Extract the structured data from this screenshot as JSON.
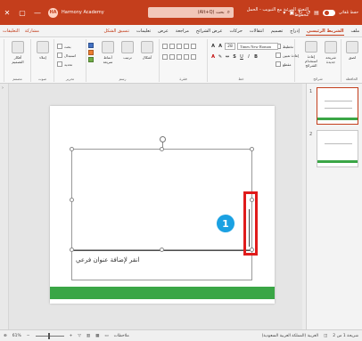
{
  "titlebar": {
    "account_name": "Harmony Academy",
    "avatar_initials": "HA",
    "search_placeholder": "بحث (Alt+Q)",
    "doc_title": "التعبئة المرئية مع التبويب - الحمل محفوظ",
    "autosave_label": "حفظ تلقائي",
    "win_controls": [
      "✕",
      "▢",
      "—"
    ]
  },
  "ribbon_tabs": {
    "tabs": [
      {
        "label": "ملف"
      },
      {
        "label": "الشريط الرئيسي",
        "active": true
      },
      {
        "label": "إدراج"
      },
      {
        "label": "تصميم"
      },
      {
        "label": "انتقالات"
      },
      {
        "label": "حركات"
      },
      {
        "label": "عرض الشرائح"
      },
      {
        "label": "مراجعة"
      },
      {
        "label": "عرض"
      },
      {
        "label": "تعليمات"
      },
      {
        "label": "تنسيق الشكل",
        "shape": true
      }
    ],
    "actions": {
      "share": "مشاركة",
      "comments": "التعليقات"
    }
  },
  "ribbon": {
    "clipboard": {
      "paste": "لصق",
      "group": "الحافظة"
    },
    "slides": {
      "new_slide": "شريحة جديدة",
      "reuse": "إعادة استخدام الشرائح",
      "layout": "تخطيط",
      "reset": "إعادة تعيين",
      "section": "مقطع",
      "group": "شرائح"
    },
    "font": {
      "name": "Times New Roman",
      "size": "28",
      "group": "خط"
    },
    "paragraph": {
      "group": "فقرة"
    },
    "drawing": {
      "shapes": "أشكال",
      "arrange": "ترتيب",
      "quick_styles": "أنماط سريعة",
      "group": "رسم"
    },
    "editing": {
      "find": "بحث",
      "replace": "استبدال",
      "select": "تحديد",
      "group": "تحرير"
    },
    "voice": {
      "dictate": "إملاء",
      "group": "صوت"
    },
    "designer": {
      "label": "أفكار التصميم",
      "group": "مصمم"
    }
  },
  "slide": {
    "subtitle_placeholder": "انقر لإضافة عنوان فرعي",
    "callout_number": "1",
    "green_color": "#3aa646",
    "highlight_color": "#e01b1b",
    "callout_color": "#1ba1e2"
  },
  "thumbnails": [
    {
      "num": "1",
      "selected": true
    },
    {
      "num": "2",
      "selected": false
    }
  ],
  "statusbar": {
    "zoom": "61%",
    "slide_info": "شريحة 1 من 2",
    "language": "العربية (المملكة العربية السعودية)",
    "notes": "ملاحظات"
  },
  "colors": {
    "brand": "#c43e1c",
    "canvas": "#e5e5e5"
  }
}
